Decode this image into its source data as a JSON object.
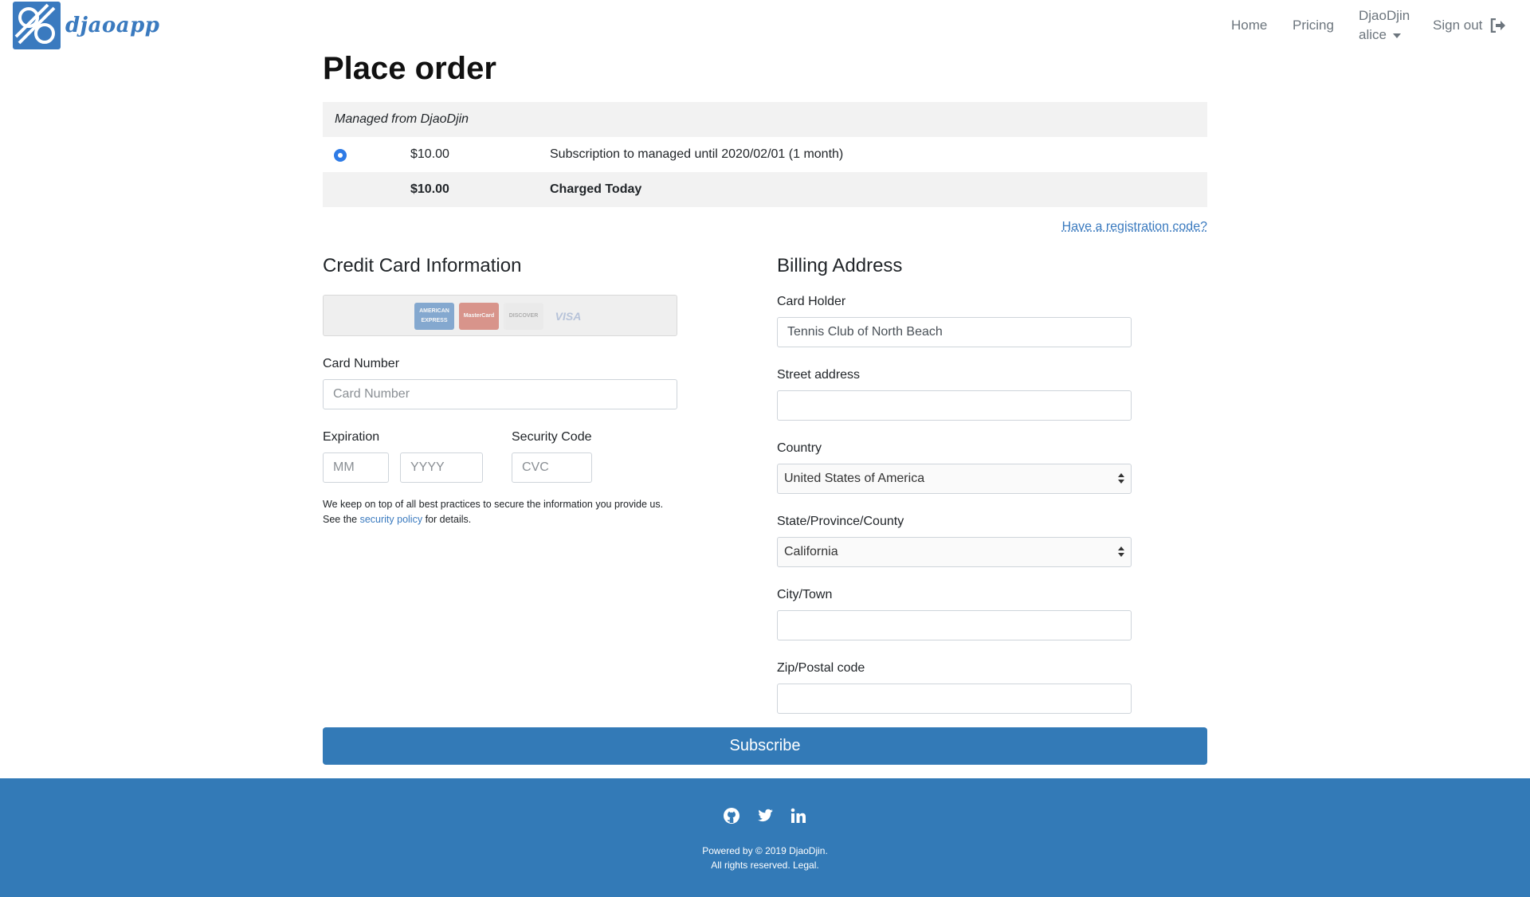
{
  "brand": {
    "name": "djaoapp"
  },
  "nav": {
    "home": "Home",
    "pricing": "Pricing",
    "org": "DjaoDjin",
    "user": "alice",
    "signout": "Sign out"
  },
  "page": {
    "title": "Place order"
  },
  "plan": {
    "header": "Managed from DjaoDjin",
    "option": {
      "amount": "$10.00",
      "description": "Subscription to managed until 2020/02/01 (1 month)"
    },
    "total": {
      "amount": "$10.00",
      "label": "Charged Today"
    }
  },
  "registration_link": "Have a registration code?",
  "credit_card": {
    "title": "Credit Card Information",
    "card_logos": [
      "AMERICAN EXPRESS",
      "MasterCard",
      "DISCOVER",
      "VISA"
    ],
    "card_number_label": "Card Number",
    "card_number_placeholder": "Card Number",
    "expiration_label": "Expiration",
    "month_placeholder": "MM",
    "year_placeholder": "YYYY",
    "security_label": "Security Code",
    "cvc_placeholder": "CVC",
    "note_line1": "We keep on top of all best practices to secure the information you provide us.",
    "note_prefix": "See the",
    "note_link": "security policy",
    "note_suffix": "for details."
  },
  "billing": {
    "title": "Billing Address",
    "card_holder_label": "Card Holder",
    "card_holder_value": "Tennis Club of North Beach",
    "street_label": "Street address",
    "street_value": "",
    "country_label": "Country",
    "country_value": "United States of America",
    "state_label": "State/Province/County",
    "state_value": "California",
    "city_label": "City/Town",
    "city_value": "",
    "zip_label": "Zip/Postal code",
    "zip_value": ""
  },
  "subscribe_label": "Subscribe",
  "footer": {
    "line1": "Powered by © 2019 DjaoDjin.",
    "line2": "All rights reserved. Legal.",
    "icons": [
      "github-icon",
      "twitter-icon",
      "linkedin-icon"
    ]
  },
  "colors": {
    "primary": "#337ab7",
    "radio": "#2e7be6",
    "muted": "#6c757d"
  }
}
